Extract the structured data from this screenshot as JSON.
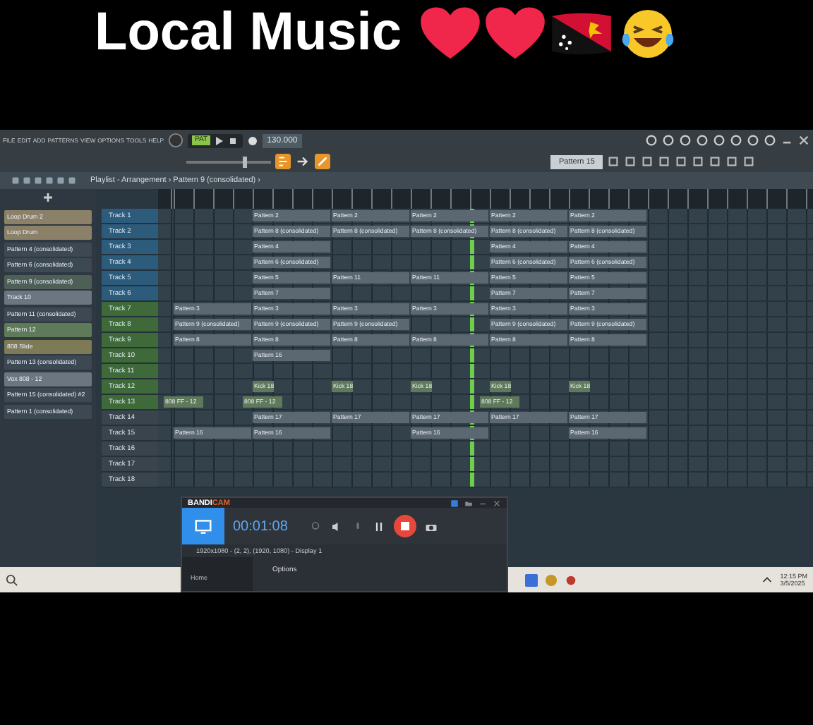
{
  "caption": "Local Music",
  "menu": [
    "FILE",
    "EDIT",
    "ADD",
    "PATTERNS",
    "VIEW",
    "OPTIONS",
    "TOOLS",
    "HELP"
  ],
  "transport": {
    "mode": "PAT",
    "tempo": "130.000"
  },
  "master_volume": {
    "level": 0.7
  },
  "pattern_selector": "Pattern 15",
  "playlist_title": "Playlist - Arrangement › Pattern 9 (consolidated) ›",
  "picker": [
    {
      "label": "Loop Drum 2",
      "color": "#8a8168"
    },
    {
      "label": "Loop Drum",
      "color": "#8a8168"
    },
    {
      "label": "Pattern 4 (consolidated)",
      "color": "#3c4852"
    },
    {
      "label": "Pattern 6 (consolidated)",
      "color": "#3c4852"
    },
    {
      "label": "Pattern 9 (consolidated)",
      "color": "#4e5f58"
    },
    {
      "label": "Track 10",
      "color": "#6b7680"
    },
    {
      "label": "Pattern 11 (consolidated)",
      "color": "#3c4852"
    },
    {
      "label": "Pattern 12",
      "color": "#5f7a58"
    },
    {
      "label": "808 Slide",
      "color": "#7d7a56"
    },
    {
      "label": "Pattern 13 (consolidated)",
      "color": "#3c4852"
    },
    {
      "label": "Vox 808 - 12",
      "color": "#6b7680"
    },
    {
      "label": "Pattern 15 (consolidated) #2",
      "color": "#3c4852"
    },
    {
      "label": "Pattern 1 (consolidated)",
      "color": "#3c4852"
    }
  ],
  "tracks": [
    {
      "name": "Track 1",
      "color": "#2d5b7c",
      "clips": [
        {
          "kind": "gap"
        },
        {
          "kind": "clip",
          "label": "Pattern 2"
        },
        {
          "kind": "clip",
          "label": "Pattern 2"
        },
        {
          "kind": "clip",
          "label": "Pattern 2"
        },
        {
          "kind": "clip",
          "label": "Pattern 2"
        },
        {
          "kind": "clip",
          "label": "Pattern 2"
        }
      ]
    },
    {
      "name": "Track 2",
      "color": "#2d5b7c",
      "clips": [
        {
          "kind": "gap"
        },
        {
          "kind": "clip",
          "label": "Pattern 8 (consolidated)"
        },
        {
          "kind": "clip",
          "label": "Pattern 8 (consolidated)"
        },
        {
          "kind": "clip",
          "label": "Pattern 8 (consolidated)"
        },
        {
          "kind": "clip",
          "label": "Pattern 8 (consolidated)"
        },
        {
          "kind": "clip",
          "label": "Pattern 8 (consolidated)"
        }
      ]
    },
    {
      "name": "Track 3",
      "color": "#2d5b7c",
      "clips": [
        {
          "kind": "gap"
        },
        {
          "kind": "clip",
          "label": "Pattern 4"
        },
        {
          "kind": "gap"
        },
        {
          "kind": "gap"
        },
        {
          "kind": "clip",
          "label": "Pattern 4"
        },
        {
          "kind": "clip",
          "label": "Pattern 4"
        }
      ]
    },
    {
      "name": "Track 4",
      "color": "#2d5b7c",
      "clips": [
        {
          "kind": "gap"
        },
        {
          "kind": "clip",
          "label": "Pattern 6 (consolidated)"
        },
        {
          "kind": "gap"
        },
        {
          "kind": "gap"
        },
        {
          "kind": "clip",
          "label": "Pattern 6 (consolidated)"
        },
        {
          "kind": "clip",
          "label": "Pattern 6 (consolidated)"
        }
      ]
    },
    {
      "name": "Track 5",
      "color": "#2d5b7c",
      "clips": [
        {
          "kind": "gap"
        },
        {
          "kind": "clip",
          "label": "Pattern 5"
        },
        {
          "kind": "clip",
          "label": "Pattern 11"
        },
        {
          "kind": "clip",
          "label": "Pattern 11"
        },
        {
          "kind": "clip",
          "label": "Pattern 5"
        },
        {
          "kind": "clip",
          "label": "Pattern 5"
        }
      ]
    },
    {
      "name": "Track 6",
      "color": "#2d5b7c",
      "clips": [
        {
          "kind": "gap"
        },
        {
          "kind": "clip",
          "label": "Pattern 7"
        },
        {
          "kind": "gap"
        },
        {
          "kind": "gap"
        },
        {
          "kind": "clip",
          "label": "Pattern 7"
        },
        {
          "kind": "clip",
          "label": "Pattern 7"
        }
      ]
    },
    {
      "name": "Track 7",
      "color": "#3e6a3a",
      "clips": [
        {
          "kind": "clip",
          "label": "Pattern 3"
        },
        {
          "kind": "clip",
          "label": "Pattern 3"
        },
        {
          "kind": "clip",
          "label": "Pattern 3"
        },
        {
          "kind": "clip",
          "label": "Pattern 3"
        },
        {
          "kind": "clip",
          "label": "Pattern 3"
        },
        {
          "kind": "clip",
          "label": "Pattern 3"
        }
      ]
    },
    {
      "name": "Track 8",
      "color": "#3e6a3a",
      "clips": [
        {
          "kind": "clip",
          "label": "Pattern 9 (consolidated)"
        },
        {
          "kind": "clip",
          "label": "Pattern 9 (consolidated)"
        },
        {
          "kind": "clip",
          "label": "Pattern 9 (consolidated)"
        },
        {
          "kind": "gap"
        },
        {
          "kind": "clip",
          "label": "Pattern 9 (consolidated)"
        },
        {
          "kind": "clip",
          "label": "Pattern 9 (consolidated)"
        }
      ]
    },
    {
      "name": "Track 9",
      "color": "#3e6a3a",
      "clips": [
        {
          "kind": "clip",
          "label": "Pattern 8"
        },
        {
          "kind": "clip",
          "label": "Pattern 8"
        },
        {
          "kind": "clip",
          "label": "Pattern 8"
        },
        {
          "kind": "clip",
          "label": "Pattern 8"
        },
        {
          "kind": "clip",
          "label": "Pattern 8"
        },
        {
          "kind": "clip",
          "label": "Pattern 8"
        }
      ]
    },
    {
      "name": "Track 10",
      "color": "#3e6a3a",
      "clips": [
        {
          "kind": "gap"
        },
        {
          "kind": "clip",
          "label": "Pattern 16"
        }
      ]
    },
    {
      "name": "Track 11",
      "color": "#3e6a3a"
    },
    {
      "name": "Track 12",
      "color": "#3e6a3a",
      "clips": [
        {
          "kind": "gap"
        },
        {
          "kind": "short",
          "label": "Kick 18"
        },
        {
          "kind": "short",
          "label": "Kick 18"
        },
        {
          "kind": "short",
          "label": "Kick 18"
        },
        {
          "kind": "short",
          "label": "Kick 18"
        },
        {
          "kind": "short",
          "label": "Kick 18"
        }
      ]
    },
    {
      "name": "Track 13",
      "color": "#3e6a3a",
      "clips": [
        {
          "kind": "offset",
          "label": "808 FF - 12"
        },
        {
          "kind": "offset",
          "label": "808 FF - 12"
        },
        {
          "kind": "gap"
        },
        {
          "kind": "gap"
        },
        {
          "kind": "offset",
          "label": "808 FF - 12"
        }
      ]
    },
    {
      "name": "Track 14",
      "color": "#3a444d",
      "clips": [
        {
          "kind": "gap"
        },
        {
          "kind": "clip",
          "label": "Pattern 17"
        },
        {
          "kind": "clip",
          "label": "Pattern 17"
        },
        {
          "kind": "clip",
          "label": "Pattern 17"
        },
        {
          "kind": "clip",
          "label": "Pattern 17"
        },
        {
          "kind": "clip",
          "label": "Pattern 17"
        }
      ]
    },
    {
      "name": "Track 15",
      "color": "#3a444d",
      "clips": [
        {
          "kind": "clip",
          "label": "Pattern 16"
        },
        {
          "kind": "clip",
          "label": "Pattern 16"
        },
        {
          "kind": "gap"
        },
        {
          "kind": "clip",
          "label": "Pattern 16"
        },
        {
          "kind": "gap"
        },
        {
          "kind": "clip",
          "label": "Pattern 16"
        }
      ]
    },
    {
      "name": "Track 16",
      "color": "#3a444d"
    },
    {
      "name": "Track 17",
      "color": "#3a444d"
    },
    {
      "name": "Track 18",
      "color": "#3a444d"
    }
  ],
  "bandicam": {
    "brand_a": "BANDI",
    "brand_b": "CAM",
    "timer": "00:01:08",
    "source": "1920x1080 - (2, 2), (1920, 1080) - Display 1",
    "nav": "Home",
    "section": "Options"
  },
  "taskbar": {
    "time": "12:15 PM",
    "date": "3/5/2025"
  }
}
